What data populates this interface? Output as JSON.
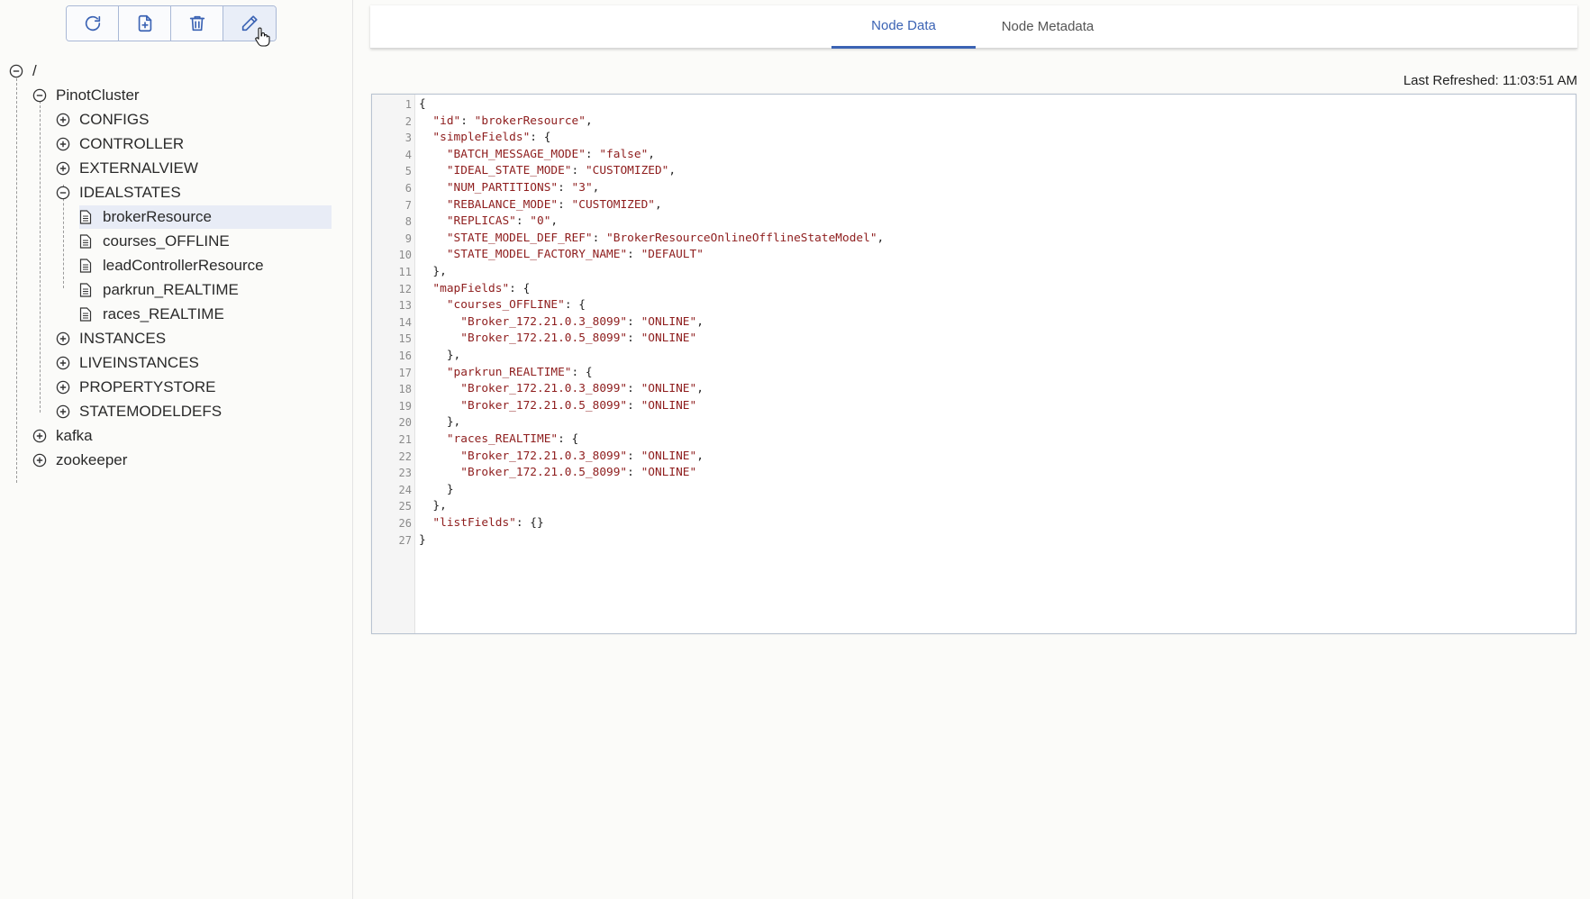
{
  "toolbar": {
    "buttons": [
      {
        "name": "refresh-button",
        "icon": "refresh-icon"
      },
      {
        "name": "add-node-button",
        "icon": "file-plus-icon"
      },
      {
        "name": "delete-button",
        "icon": "trash-icon"
      },
      {
        "name": "edit-button",
        "icon": "pencil-icon",
        "active": true
      }
    ]
  },
  "tree": {
    "root_label": "/",
    "nodes": [
      {
        "label": "PinotCluster",
        "expanded": true
      },
      {
        "label": "CONFIGS",
        "expanded": false
      },
      {
        "label": "CONTROLLER",
        "expanded": false
      },
      {
        "label": "EXTERNALVIEW",
        "expanded": false
      },
      {
        "label": "IDEALSTATES",
        "expanded": true
      },
      {
        "label": "brokerResource",
        "selected": true
      },
      {
        "label": "courses_OFFLINE"
      },
      {
        "label": "leadControllerResource"
      },
      {
        "label": "parkrun_REALTIME"
      },
      {
        "label": "races_REALTIME"
      },
      {
        "label": "INSTANCES",
        "expanded": false
      },
      {
        "label": "LIVEINSTANCES",
        "expanded": false
      },
      {
        "label": "PROPERTYSTORE",
        "expanded": false
      },
      {
        "label": "STATEMODELDEFS",
        "expanded": false
      },
      {
        "label": "kafka",
        "expanded": false
      },
      {
        "label": "zookeeper",
        "expanded": false
      }
    ]
  },
  "tabs": {
    "node_data": "Node Data",
    "node_metadata": "Node Metadata",
    "active": "Node Data"
  },
  "last_refreshed": "Last Refreshed: 11:03:51 AM",
  "editor": {
    "lines": [
      "{",
      "  \"id\": \"brokerResource\",",
      "  \"simpleFields\": {",
      "    \"BATCH_MESSAGE_MODE\": \"false\",",
      "    \"IDEAL_STATE_MODE\": \"CUSTOMIZED\",",
      "    \"NUM_PARTITIONS\": \"3\",",
      "    \"REBALANCE_MODE\": \"CUSTOMIZED\",",
      "    \"REPLICAS\": \"0\",",
      "    \"STATE_MODEL_DEF_REF\": \"BrokerResourceOnlineOfflineStateModel\",",
      "    \"STATE_MODEL_FACTORY_NAME\": \"DEFAULT\"",
      "  },",
      "  \"mapFields\": {",
      "    \"courses_OFFLINE\": {",
      "      \"Broker_172.21.0.3_8099\": \"ONLINE\",",
      "      \"Broker_172.21.0.5_8099\": \"ONLINE\"",
      "    },",
      "    \"parkrun_REALTIME\": {",
      "      \"Broker_172.21.0.3_8099\": \"ONLINE\",",
      "      \"Broker_172.21.0.5_8099\": \"ONLINE\"",
      "    },",
      "    \"races_REALTIME\": {",
      "      \"Broker_172.21.0.3_8099\": \"ONLINE\",",
      "      \"Broker_172.21.0.5_8099\": \"ONLINE\"",
      "    }",
      "  },",
      "  \"listFields\": {}",
      "}"
    ]
  },
  "colors": {
    "accent": "#3b63b4",
    "json_string": "#8e1d1d",
    "selected_row": "#e8ecf6"
  }
}
